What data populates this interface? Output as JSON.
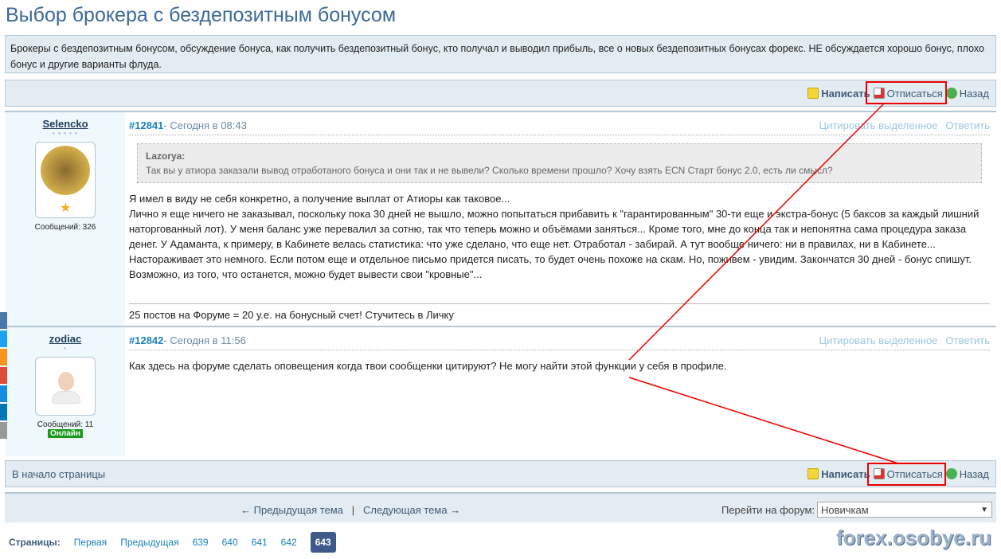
{
  "title": "Выбор брокера с бездепозитным бонусом",
  "description": "Брокеры с бездепозитным бонусом, обсуждение бонуса, как получить бездепозитный бонус, кто получал и выводил прибыль, все о новых бездепозитных бонусах форекс. НЕ обсуждается хорошо бонус, плохо бонус и другие варианты флуда.",
  "toolbar": {
    "write": "Написать",
    "unsubscribe": "Отписаться",
    "back": "Назад",
    "to_top": "В начало страницы"
  },
  "post_actions": {
    "quote_selected": "Цитировать выделенное",
    "reply": "Ответить"
  },
  "posts": [
    {
      "author": "Selencko",
      "stars": "• • • • •",
      "messages": "Сообщений: 326",
      "num": "#12841",
      "date": " - Сегодня в 08:43",
      "quote_author": "Lazorya:",
      "quote_text": "Так вы у атиора заказали вывод отработаного бонуса и они так и не вывели? Сколько времени прошло? Хочу взять ECN Старт бонус 2.0, есть ли смысл?",
      "text": "Я имел в виду не себя конкретно, а получение выплат от Атиоры как таковое...\nЛично я еще ничего не заказывал, поскольку пока 30 дней не вышло, можно попытаться прибавить к \"гарантированным\" 30-ти еще и экстра-бонус (5 баксов за каждый лишний наторгованный лот). У меня баланс уже перевалил за сотню, так что теперь можно и объёмами заняться... Кроме того, мне до конца так и непонятна сама процедура заказа денег. У Адаманта, к примеру, в Кабинете велась статистика: что уже сделано, что еще нет. Отработал - забирай. А тут вообще ничего: ни в правилах, ни в Кабинете... Настораживает это немного. Если потом еще и отдельное письмо придется писать, то будет очень похоже на скам. Но, поживем - увидим. Закончатся 30 дней - бонус спишут. Возможно, из того, что останется, можно будет вывести свои \"кровные\"...",
      "signature": "25 постов на Форуме = 20 у.е. на бонусный счет! Стучитесь в Личку"
    },
    {
      "author": "zodiac",
      "stars": "•",
      "messages": "Сообщений: 11",
      "status": "Онлайн",
      "num": "#12842",
      "date": " - Сегодня в 11:56",
      "text": "Как здесь на форуме сделать оповещения когда твои сообщенки цитируют? Не могу найти этой функции у себя в профиле."
    }
  ],
  "nav": {
    "prev": "Предыдущая тема",
    "next": "Следующая тема",
    "sep": "|",
    "jump_label": "Перейти на форум:",
    "forum": "Новичкам"
  },
  "pagination": {
    "label": "Страницы:",
    "first": "Первая",
    "prev": "Предыдущая",
    "pages": [
      "639",
      "640",
      "641",
      "642"
    ],
    "current": "643"
  },
  "watermark": "forex.osobye.ru",
  "social": [
    {
      "name": "vk",
      "color": "#4a76a8"
    },
    {
      "name": "twitter",
      "color": "#1da1f2"
    },
    {
      "name": "odnoklassniki",
      "color": "#f7931e"
    },
    {
      "name": "google-plus",
      "color": "#dd4b39"
    },
    {
      "name": "mail-ru",
      "color": "#168de2"
    },
    {
      "name": "linkedin",
      "color": "#0077b5"
    },
    {
      "name": "more",
      "color": "#999999"
    }
  ]
}
